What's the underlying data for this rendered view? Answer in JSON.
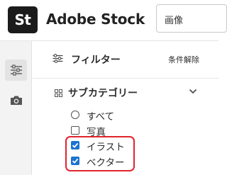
{
  "header": {
    "logo_badge": "St",
    "logo_text": "Adobe Stock",
    "search_value": "画像"
  },
  "rail": {
    "items": [
      {
        "icon": "sliders-icon",
        "active": true
      },
      {
        "icon": "camera-icon",
        "active": false
      }
    ]
  },
  "filters": {
    "title": "フィルター",
    "clear_label": "条件解除"
  },
  "subcategory": {
    "title": "サブカテゴリー",
    "expanded": true,
    "options": [
      {
        "label": "すべて",
        "control": "radio",
        "checked": false
      },
      {
        "label": "写真",
        "control": "checkbox",
        "checked": false
      },
      {
        "label": "イラスト",
        "control": "checkbox",
        "checked": true
      },
      {
        "label": "ベクター",
        "control": "checkbox",
        "checked": true
      }
    ]
  },
  "colors": {
    "checkbox_checked": "#1a73d1",
    "highlight": "#e0242e"
  }
}
